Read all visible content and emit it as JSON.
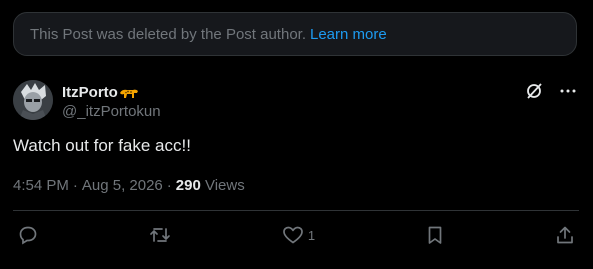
{
  "deleted_notice": {
    "text": "This Post was deleted by the Post author.",
    "link": "Learn more"
  },
  "author": {
    "display_name": "ItzPorto",
    "handle": "@_itzPortokun"
  },
  "post": {
    "text": "Watch out for fake acc!!",
    "time": "4:54 PM",
    "date": "Aug 5, 2026",
    "views_count": "290",
    "views_label": "Views"
  },
  "actions": {
    "likes": "1"
  },
  "colors": {
    "background": "#000000",
    "accent": "#1d9bf0",
    "muted": "#71767b",
    "text": "#e7e9ea",
    "border": "#2f3336"
  }
}
